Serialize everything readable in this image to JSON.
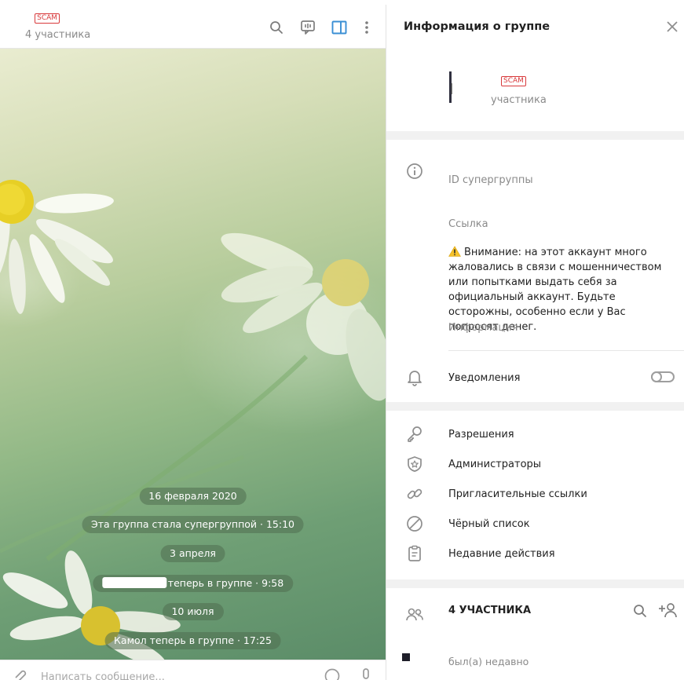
{
  "chat": {
    "scam_badge": "SCAM",
    "subtitle": "4 участника",
    "composer_placeholder": "Написать сообщение...",
    "service_messages": [
      "16 февраля 2020",
      "Эта группа стала супергруппой · 15:10",
      "3 апреля",
      "теперь в группе · 9:58",
      "10 июля",
      "Камол теперь в группе · 17:25"
    ]
  },
  "panel": {
    "title": "Информация о группе",
    "scam_badge": "SCAM",
    "group_subtitle": "участника",
    "id_label": "ID супергруппы",
    "link_label": "Ссылка",
    "warning_text": "Внимание: на этот аккаунт много жаловались в связи с мошенничеством или попытками выдать себя за официальный аккаунт. Будьте осторожны, особенно если у Вас попросят денег.",
    "warning_label": "Информация",
    "notifications_label": "Уведомления",
    "notifications_enabled": false,
    "menu": [
      "Разрешения",
      "Администраторы",
      "Пригласительные ссылки",
      "Чёрный список",
      "Недавние действия"
    ],
    "members_header": "4 УЧАСТНИКА",
    "member_status": "был(а) недавно"
  },
  "colors": {
    "accent": "#3a8fd4",
    "scam": "#d8393b",
    "muted": "#8a8a8a"
  }
}
